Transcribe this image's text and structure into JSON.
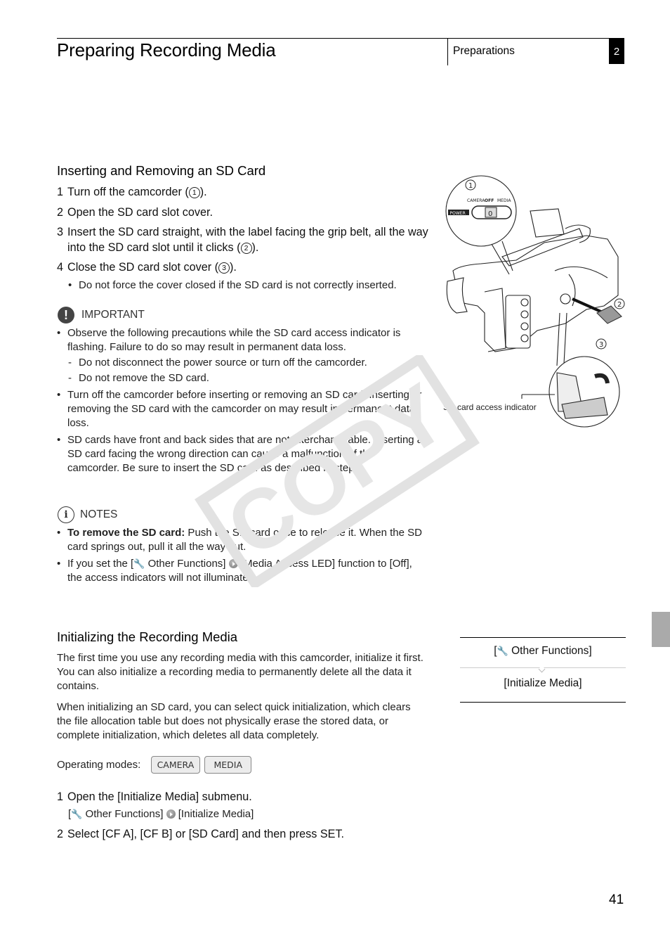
{
  "header": {
    "title": "Preparing Recording Media",
    "section": "Preparations",
    "chapter": "2"
  },
  "sd_section": {
    "heading": "Inserting and Removing an SD Card",
    "steps": [
      {
        "num": "1",
        "text_before": "Turn off the camcorder (",
        "ref": "1",
        "text_after": ")."
      },
      {
        "num": "2",
        "text": "Open the SD card slot cover."
      },
      {
        "num": "3",
        "text_before": "Insert the SD card straight, with the label facing the grip belt, all the way into the SD card slot until it clicks (",
        "ref": "2",
        "text_after": ")."
      },
      {
        "num": "4",
        "text_before": "Close the SD card slot cover (",
        "ref": "3",
        "text_after": ")."
      }
    ],
    "step4_note": "Do not force the cover closed if the SD card is not correctly inserted."
  },
  "important": {
    "label": "IMPORTANT",
    "items": [
      {
        "text": "Observe the following precautions while the SD card access indicator is flashing. Failure to do so may result in permanent data loss.",
        "subitems": [
          "Do not disconnect the power source or turn off the camcorder.",
          "Do not remove the SD card."
        ]
      },
      {
        "text": "Turn off the camcorder before inserting or removing an SD card. Inserting or removing the SD card with the camcorder on may result in permanent data loss."
      },
      {
        "text": "SD cards have front and back sides that are not interchangeable. Inserting an SD card facing the wrong direction can cause a malfunction of the camcorder. Be sure to insert the SD card as described in step 3."
      }
    ]
  },
  "notes": {
    "label": "NOTES",
    "item1_bold": "To remove the SD card:",
    "item1_text": " Push the SD card once to release it. When the SD card springs out, pull it all the way out.",
    "item2_a": "If you set the [",
    "item2_menu": " Other Functions]",
    "item2_b": " [Media Access LED] function to [Off], the access indicators will not illuminate."
  },
  "illustration": {
    "callouts": [
      "1",
      "2",
      "3"
    ],
    "switch_labels": {
      "camera": "CAMERA",
      "off": "OFF",
      "media": "MEDIA",
      "power": "POWER",
      "position": "0"
    },
    "access_indicator_label": "SD card access indicator"
  },
  "init_section": {
    "heading": "Initializing the Recording Media",
    "para1": "The first time you use any recording media with this camcorder, initialize it first. You can also initialize a recording media to permanently delete all the data it contains.",
    "para2": "When initializing an SD card, you can select quick initialization, which clears the file allocation table but does not physically erase the stored data, or complete initialization, which deletes all data completely.",
    "modes_label": "Operating modes:",
    "modes": [
      "CAMERA",
      "MEDIA"
    ],
    "step1_num": "1",
    "step1": "Open the [Initialize Media] submenu.",
    "step1_path_a": " Other Functions]",
    "step1_path_b": " [Initialize Media]",
    "step2_num": "2",
    "step2": "Select [CF A], [CF B] or [SD Card] and then press SET."
  },
  "menu_path": {
    "level1": " Other Functions]",
    "level2": "[Initialize Media]"
  },
  "watermark": "COPY",
  "page_number": "41"
}
